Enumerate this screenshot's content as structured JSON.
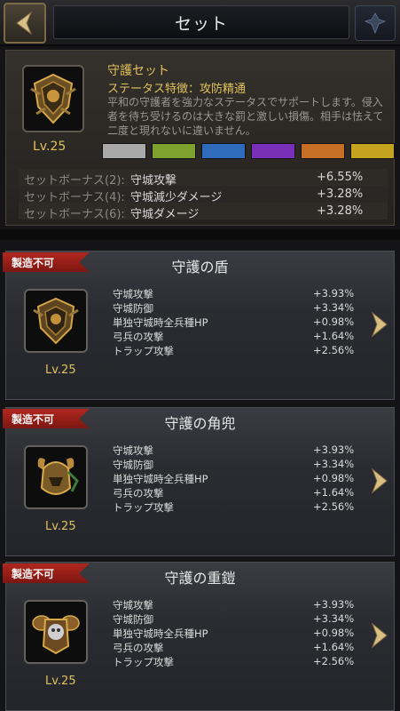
{
  "header": {
    "title": "セット",
    "back_icon": "chevron-left-icon",
    "deco_icon": "ornament-icon"
  },
  "set": {
    "name": "守護セット",
    "trait": "ステータス特徴：攻防精通",
    "description": "平和の守護者を強力なステータスでサポートします。侵入者を待ち受けるのは大きな罰と激しい損傷。相手は怯えて二度と現れないに違いません。",
    "level": "Lv.25",
    "icon": "shield-crest-icon",
    "swatch_colors": [
      "#a9a9a9",
      "#7fa12d",
      "#2f6dbc",
      "#7a2fb8",
      "#c77025",
      "#c6a31e"
    ],
    "bonuses": [
      {
        "label": "セットボーナス(2):",
        "stat": "守城攻撃",
        "value": "+6.55%"
      },
      {
        "label": "セットボーナス(4):",
        "stat": "守城減少ダメージ",
        "value": "+3.28%"
      },
      {
        "label": "セットボーナス(6):",
        "stat": "守城ダメージ",
        "value": "+3.28%"
      }
    ]
  },
  "items": [
    {
      "badge": "製造不可",
      "name": "守護の盾",
      "level": "Lv.25",
      "icon": "shield-icon",
      "stats": [
        {
          "name": "守城攻撃",
          "value": "+3.93%"
        },
        {
          "name": "守城防御",
          "value": "+3.34%"
        },
        {
          "name": "単独守城時全兵種HP",
          "value": "+0.98%"
        },
        {
          "name": "弓兵の攻撃",
          "value": "+1.64%"
        },
        {
          "name": "トラップ攻撃",
          "value": "+2.56%"
        }
      ]
    },
    {
      "badge": "製造不可",
      "name": "守護の角兜",
      "level": "Lv.25",
      "icon": "horned-helmet-icon",
      "stats": [
        {
          "name": "守城攻撃",
          "value": "+3.93%"
        },
        {
          "name": "守城防御",
          "value": "+3.34%"
        },
        {
          "name": "単独守城時全兵種HP",
          "value": "+0.98%"
        },
        {
          "name": "弓兵の攻撃",
          "value": "+1.64%"
        },
        {
          "name": "トラップ攻撃",
          "value": "+2.56%"
        }
      ]
    },
    {
      "badge": "製造不可",
      "name": "守護の重鎧",
      "level": "Lv.25",
      "icon": "heavy-armor-icon",
      "stats": [
        {
          "name": "守城攻撃",
          "value": "+3.93%"
        },
        {
          "name": "守城防御",
          "value": "+3.34%"
        },
        {
          "name": "単独守城時全兵種HP",
          "value": "+0.98%"
        },
        {
          "name": "弓兵の攻撃",
          "value": "+1.64%"
        },
        {
          "name": "トラップ攻撃",
          "value": "+2.56%"
        }
      ]
    }
  ]
}
